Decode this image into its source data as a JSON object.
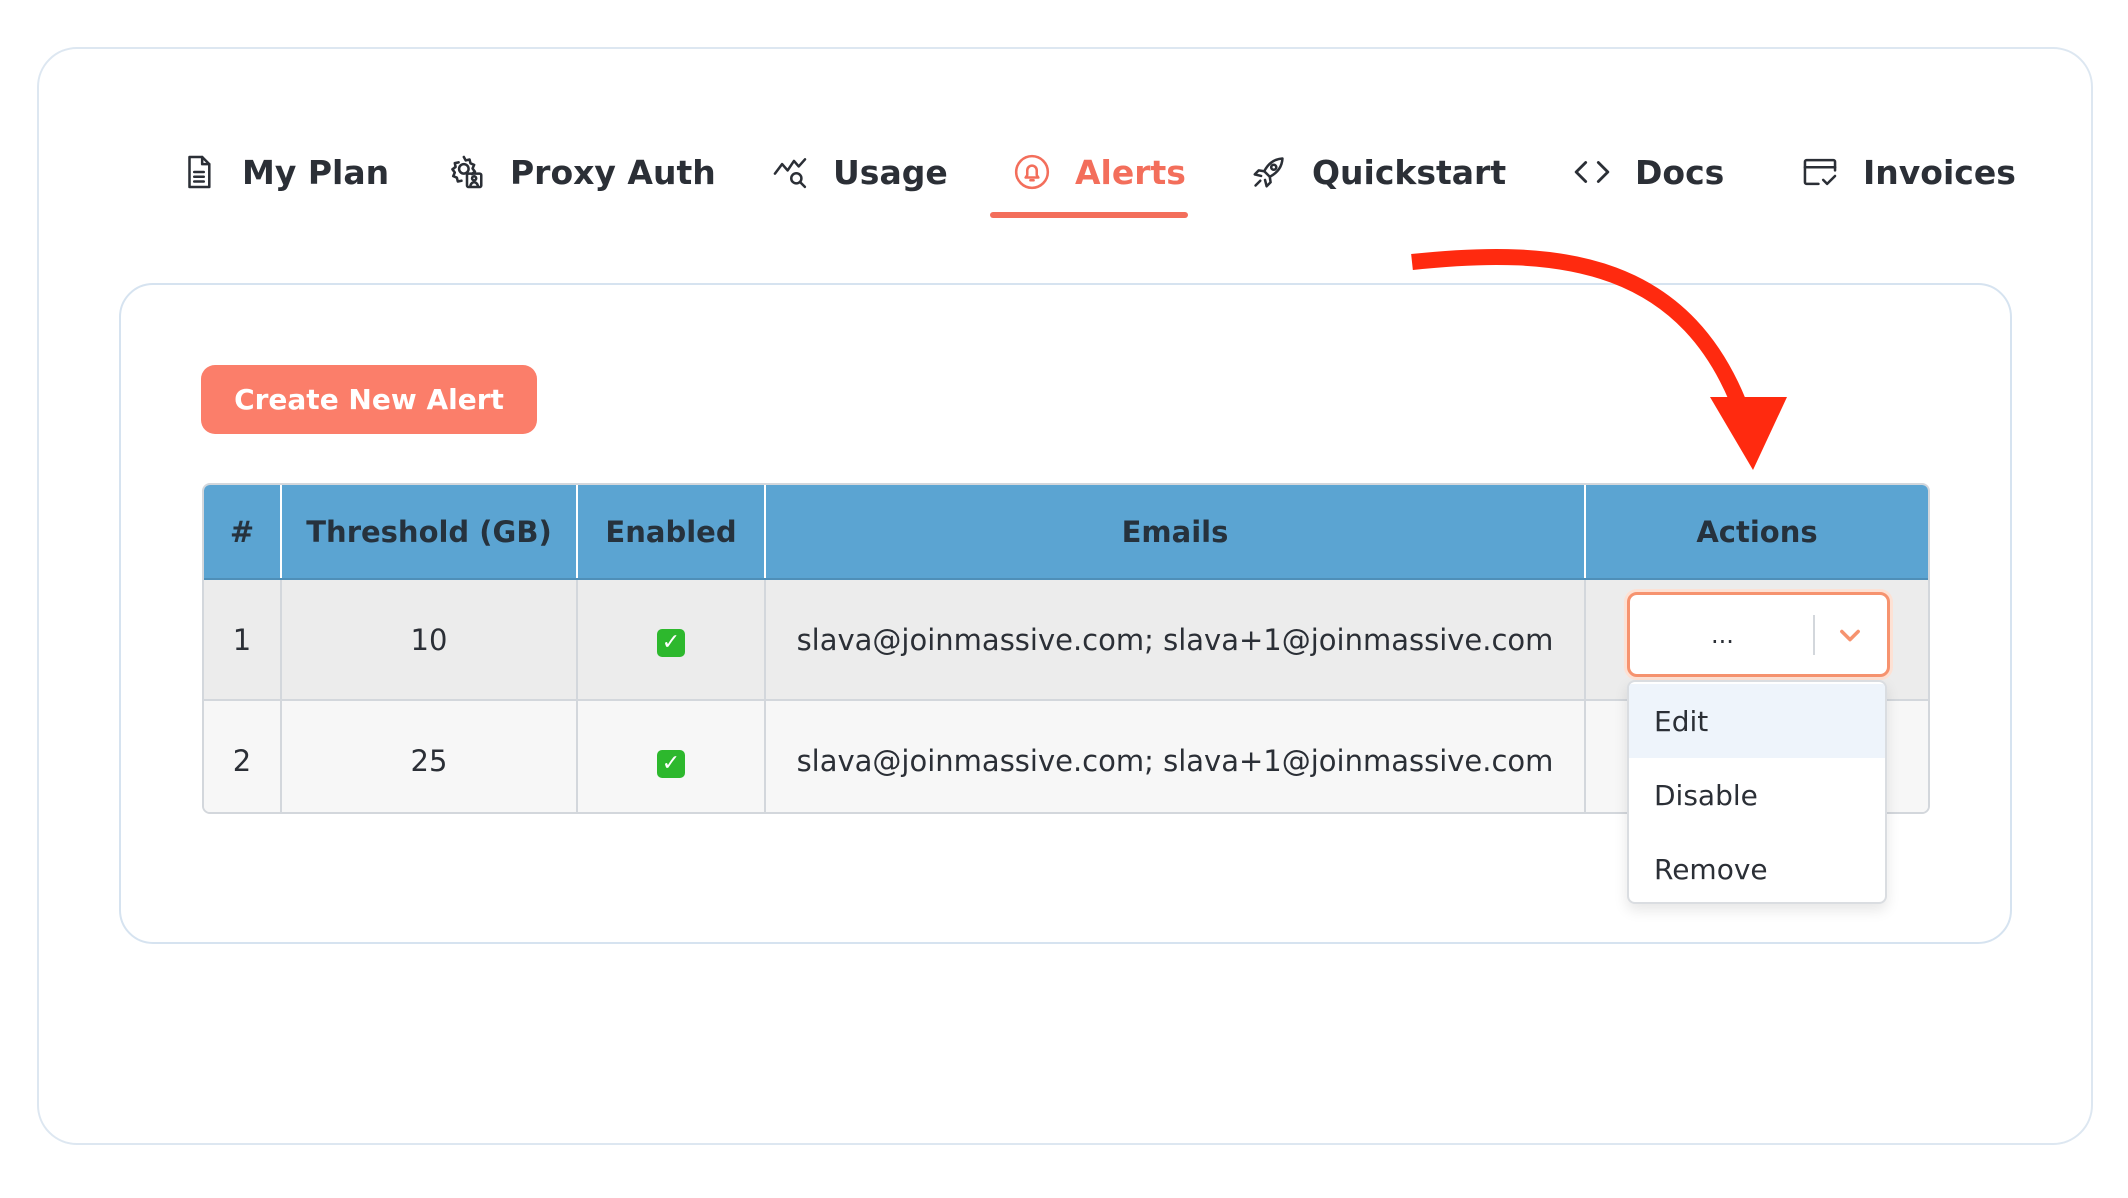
{
  "tabs": [
    {
      "label": "My Plan",
      "icon": "document-icon",
      "active": false
    },
    {
      "label": "Proxy Auth",
      "icon": "gear-user-icon",
      "active": false
    },
    {
      "label": "Usage",
      "icon": "chart-search-icon",
      "active": false
    },
    {
      "label": "Alerts",
      "icon": "bell-icon",
      "active": true
    },
    {
      "label": "Quickstart",
      "icon": "rocket-icon",
      "active": false
    },
    {
      "label": "Docs",
      "icon": "code-icon",
      "active": false
    },
    {
      "label": "Invoices",
      "icon": "invoice-icon",
      "active": false
    }
  ],
  "create_button": "Create New Alert",
  "table": {
    "headers": [
      "#",
      "Threshold (GB)",
      "Enabled",
      "Emails",
      "Actions"
    ],
    "rows": [
      {
        "num": "1",
        "threshold": "10",
        "enabled": "✓",
        "emails": "slava@joinmassive.com; slava+1@joinmassive.com"
      },
      {
        "num": "2",
        "threshold": "25",
        "enabled": "✓",
        "emails": "slava@joinmassive.com; slava+1@joinmassive.com"
      }
    ]
  },
  "actions_select": {
    "value": "...",
    "options": [
      "Edit",
      "Disable",
      "Remove"
    ]
  },
  "colors": {
    "accent": "#f36e5b",
    "header_bg": "#5ba4d2",
    "annotation_arrow": "#ff2a0f"
  }
}
